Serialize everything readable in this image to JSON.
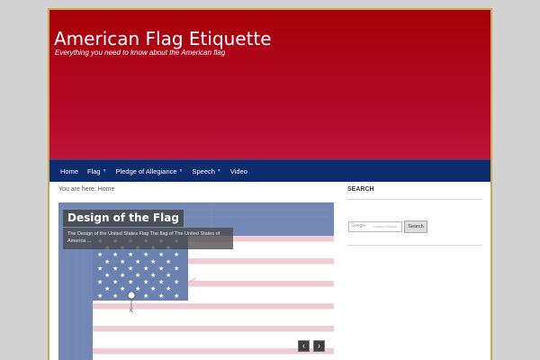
{
  "site": {
    "title": "American Flag Etiquette",
    "description": "Everything you need to know about the American flag"
  },
  "nav": {
    "items": [
      {
        "label": "Home",
        "has_submenu": false
      },
      {
        "label": "Flag",
        "has_submenu": true
      },
      {
        "label": "Pledge of Allegiance",
        "has_submenu": true
      },
      {
        "label": "Speech",
        "has_submenu": true
      },
      {
        "label": "Video",
        "has_submenu": false
      }
    ]
  },
  "breadcrumb": "You are here: Home",
  "slider": {
    "title": "Design of the Flag",
    "excerpt": "The Design of the United States Flag The flag of The United States of America ...",
    "prev_icon": "chevron-left-icon",
    "next_icon": "chevron-right-icon"
  },
  "sidebar": {
    "search_heading": "SEARCH",
    "search_brand": "Google",
    "search_placeholder": "Custom Search",
    "search_button": "Search"
  },
  "colors": {
    "header_red": "#b5092a",
    "nav_blue": "#0d2c6e",
    "frame_gold": "#c8a951",
    "flag_red": "#f0cdd4",
    "flag_blue": "#6b82b0"
  }
}
